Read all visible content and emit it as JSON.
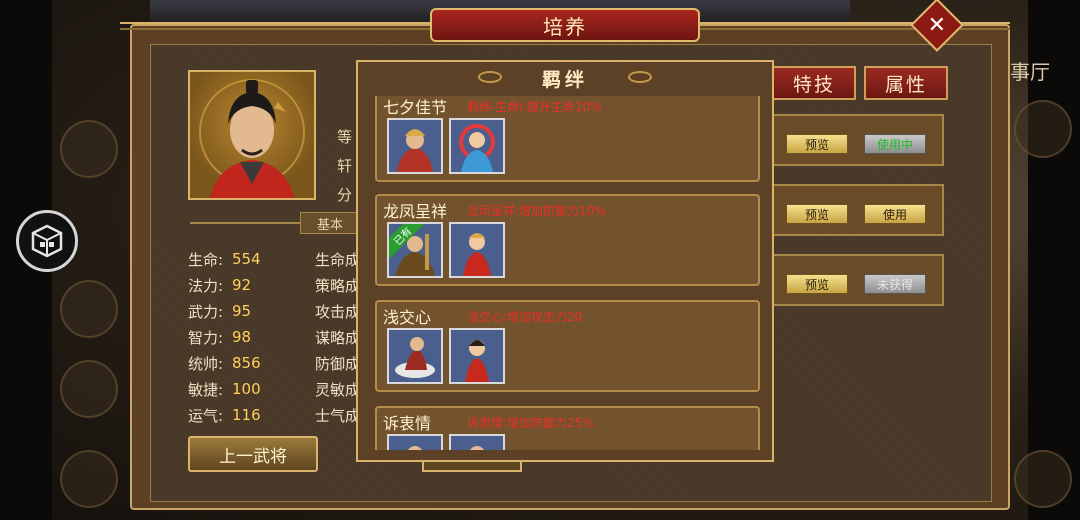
{
  "window": {
    "title": "培养",
    "close_icon": "close-icon"
  },
  "background": {
    "right_title": "议事厅",
    "left_button_icon": "hexagon-box-icon"
  },
  "hero": {
    "peek_labels": [
      "等",
      "轩",
      "分"
    ],
    "basic_tab": "基本",
    "stats_left": [
      {
        "label": "生命:",
        "value": "554"
      },
      {
        "label": "法力:",
        "value": "92"
      },
      {
        "label": "武力:",
        "value": "95"
      },
      {
        "label": "智力:",
        "value": "98"
      },
      {
        "label": "统帅:",
        "value": "856"
      },
      {
        "label": "敏捷:",
        "value": "100"
      },
      {
        "label": "运气:",
        "value": "116"
      }
    ],
    "stats_right": [
      "生命成",
      "策略成",
      "攻击成",
      "谋略成",
      "防御成",
      "灵敏成",
      "士气成"
    ],
    "prev_button": "上一武将"
  },
  "tabs": [
    "特技",
    "属性"
  ],
  "side_rows": [
    {
      "preview": "预览",
      "action": "使用中",
      "action_style": "grey-green"
    },
    {
      "preview": "预览",
      "action": "使用",
      "action_style": "gold"
    },
    {
      "preview": "预览",
      "action": "未获得",
      "action_style": "grey"
    }
  ],
  "bond_dialog": {
    "title": "羁绊",
    "bonds": [
      {
        "name": "七夕佳节",
        "desc": "羁绊-生命Ⅰ:提升生命10%",
        "chars": [
          {
            "owned": false
          },
          {
            "owned": false
          }
        ]
      },
      {
        "name": "龙凤呈祥",
        "desc": "龙凤呈祥:增加防御力10%",
        "chars": [
          {
            "owned": true,
            "owned_label": "已有"
          },
          {
            "owned": false
          }
        ]
      },
      {
        "name": "浅交心",
        "desc": "浅交心:增加攻击力20",
        "chars": [
          {
            "owned": false
          },
          {
            "owned": false
          }
        ]
      },
      {
        "name": "诉衷情",
        "desc": "诉衷情:增加防御力25%",
        "chars": [
          {
            "owned": false
          },
          {
            "owned": false
          }
        ]
      }
    ]
  },
  "colors": {
    "accent_red": "#8c1a14",
    "gold": "#d9b46a",
    "desc_red": "#ef2e26",
    "value_yellow": "#ffd15a"
  }
}
